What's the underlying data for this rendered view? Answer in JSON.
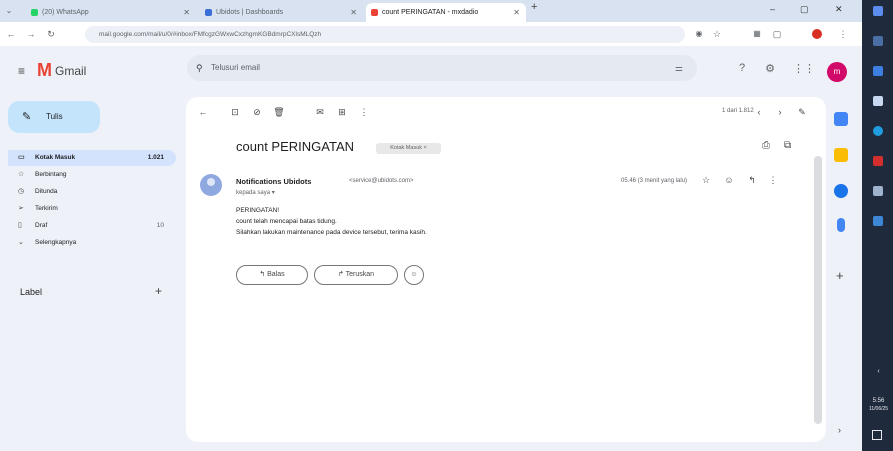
{
  "browser": {
    "tabs": [
      {
        "title": "(20) WhatsApp",
        "active": false
      },
      {
        "title": "Ubidots | Dashboards",
        "active": false
      },
      {
        "title": "count PERINGATAN - mxdadio",
        "active": true
      }
    ],
    "new_tab": "+",
    "url": "mail.google.com/mail/u/0/#inbox/FMfcgzGWxwCxzhgmKGBdmrpCXlsMLQzh",
    "window_controls": [
      "–",
      "▢",
      "✕"
    ],
    "colors": {
      "tab_strip": "#d8e2f1",
      "toolbar": "#ffffff",
      "accent": "#1a73e8"
    }
  },
  "gmail": {
    "brand": "Gmail",
    "search_placeholder": "Telusuri email",
    "avatar_initial": "m",
    "compose_label": "Tulis",
    "nav": [
      {
        "icon": "inbox-icon",
        "label": "Kotak Masuk",
        "count": "1.021",
        "active": true
      },
      {
        "icon": "star-icon",
        "label": "Berbintang",
        "count": "",
        "active": false
      },
      {
        "icon": "clock-icon",
        "label": "Ditunda",
        "count": "",
        "active": false
      },
      {
        "icon": "send-icon",
        "label": "Terkirim",
        "count": "",
        "active": false
      },
      {
        "icon": "draft-icon",
        "label": "Draf",
        "count": "10",
        "active": false
      },
      {
        "icon": "chevron-down-icon",
        "label": "Selengkapnya",
        "count": "",
        "active": false
      }
    ],
    "labels_heading": "Label",
    "pager_text": "1 dari 1.812",
    "message": {
      "subject": "count PERINGATAN",
      "folder_chip": "Kotak Masuk ×",
      "sender_name": "Notifications Ubidots",
      "sender_email": "<service@ubidots.com>",
      "recipient": "kepada saya ▾",
      "time": "05.46 (3 menit yang lalu)",
      "body": [
        "PERINGATAN!",
        "count telah mencapai batas tidung.",
        "Silahkan lakukan maintenance pada device tersebut, terima kasih."
      ]
    },
    "actions": {
      "reply": "Balas",
      "forward": "Teruskan"
    }
  },
  "taskbar": {
    "time": "5:56",
    "date": "11/06/25"
  }
}
